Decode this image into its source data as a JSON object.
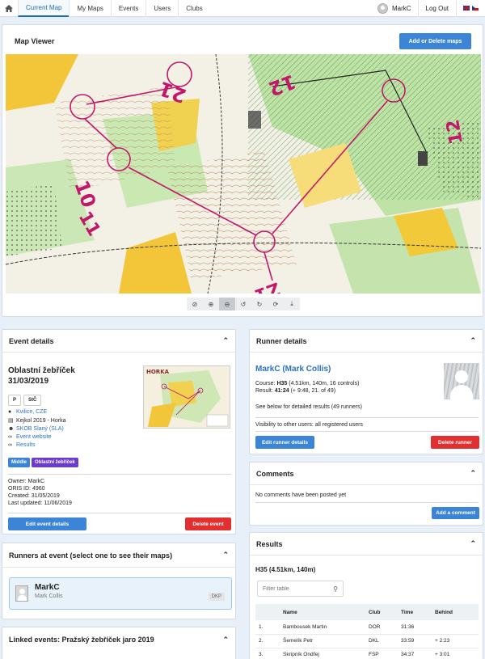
{
  "nav": {
    "tabs": [
      "Current Map",
      "My Maps",
      "Events",
      "Users",
      "Clubs"
    ],
    "username": "MarkC",
    "logout": "Log Out"
  },
  "map_viewer": {
    "title": "Map Viewer",
    "add_button": "Add or Delete maps",
    "toolbar_icons": [
      "rotate-icon",
      "zoom-in-icon",
      "zoom-out-icon",
      "rotate-left-icon",
      "rotate-right-icon",
      "reset-icon",
      "download-icon"
    ],
    "course_labels": [
      "21",
      "12",
      "10",
      "11",
      "Z1",
      "12"
    ]
  },
  "event_details": {
    "header": "Event details",
    "name": "Oblastní žebříček",
    "date": "31/03/2019",
    "badges": [
      "P",
      "StČ"
    ],
    "location": "Kvilice, CZE",
    "map": "Kejkol 2019 - Horka",
    "club": "SKOB Slaný (SLA)",
    "website": "Event website",
    "results": "Results",
    "tags": [
      {
        "label": "Middle",
        "color": "#3b84d6"
      },
      {
        "label": "Oblastní žebříček",
        "color": "#6b3bd0"
      }
    ],
    "owner": "Owner: MarkC",
    "oris": "ORIS ID: 4960",
    "created": "Created: 31/05/2019",
    "updated": "Last updated: 11/06/2019",
    "edit_button": "Edit event details",
    "delete_button": "Delete event",
    "thumb_title": "HORKA"
  },
  "runners_at_event": {
    "header": "Runners at event (select one to see their maps)",
    "runner": {
      "name": "MarkC",
      "full_name": "Mark Collis",
      "club": "DKP"
    }
  },
  "linked_events": {
    "header": "Linked events: Pražský žebříček jaro 2019"
  },
  "runner_details": {
    "header": "Runner details",
    "name": "MarkC (Mark Collis)",
    "course_prefix": "Course: ",
    "course_name": "H35",
    "course_rest": " (4.51km, 140m, 16 controls)",
    "result_prefix": "Result: ",
    "result_time": "41:24",
    "result_rest": " (+ 9:48, 21. of 49)",
    "see_below": "See below for detailed results (49 runners)",
    "visibility": "Visibility to other users: all registered users",
    "edit_button": "Edit runner details",
    "delete_button": "Delete runner"
  },
  "comments": {
    "header": "Comments",
    "empty": "No comments have been posted yet",
    "add_button": "Add a comment"
  },
  "results": {
    "header": "Results",
    "course": "H35 (4.51km, 140m)",
    "filter_placeholder": "Filter table",
    "columns": [
      "",
      "Name",
      "Club",
      "Time",
      "Behind"
    ],
    "rows": [
      [
        "1.",
        "Bambousek Martin",
        "DOR",
        "31:36",
        ""
      ],
      [
        "2.",
        "Šemelík Petr",
        "DKL",
        "33:59",
        "+ 2:23"
      ],
      [
        "3.",
        "Skripník Ondřej",
        "FSP",
        "34:37",
        "+ 3:01"
      ]
    ]
  },
  "colors": {
    "accent": "#3b84d6",
    "danger": "#e23030",
    "course_magenta": "#c2186b"
  }
}
